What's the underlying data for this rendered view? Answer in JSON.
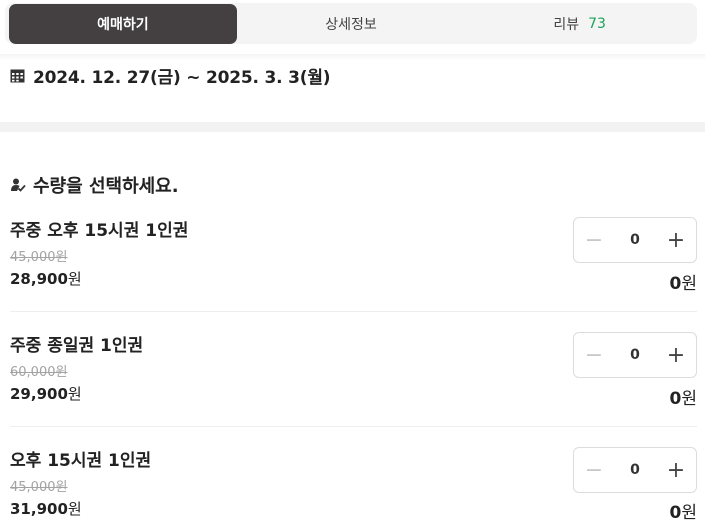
{
  "tabs": [
    {
      "label": "예매하기"
    },
    {
      "label": "상세정보"
    },
    {
      "label": "리뷰",
      "count": "73"
    }
  ],
  "period": {
    "text": "2024. 12. 27(금) ~ 2025. 3. 3(월)"
  },
  "section": {
    "title": "수량을 선택하세요."
  },
  "items": [
    {
      "name": "주중 오후 15시권 1인권",
      "original_price": "45,000원",
      "price_value": "28,900",
      "price_unit": "원",
      "quantity": "0",
      "total_value": "0",
      "total_unit": "원"
    },
    {
      "name": "주중 종일권 1인권",
      "original_price": "60,000원",
      "price_value": "29,900",
      "price_unit": "원",
      "quantity": "0",
      "total_value": "0",
      "total_unit": "원"
    },
    {
      "name": "오후 15시권 1인권",
      "original_price": "45,000원",
      "price_value": "31,900",
      "price_unit": "원",
      "quantity": "0",
      "total_value": "0",
      "total_unit": "원"
    }
  ],
  "icons": {
    "minus": "−",
    "plus": "+",
    "calendar": "calendar-icon",
    "ticket": "ticket-check-icon"
  },
  "colors": {
    "active_tab": "#444041",
    "review_count": "#1aa35a"
  }
}
